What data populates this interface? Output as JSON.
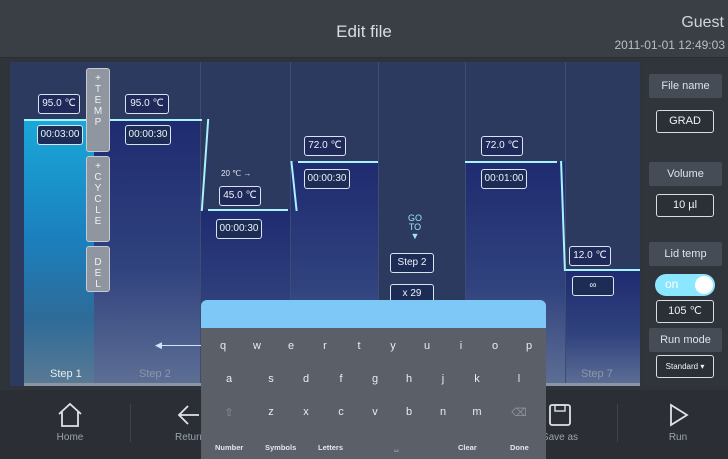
{
  "header": {
    "title": "Edit file",
    "user": "Guest",
    "datetime": "2011-01-01 12:49:03"
  },
  "side_buttons": {
    "temp": [
      "+",
      "T",
      "E",
      "M",
      "P"
    ],
    "cycle": [
      "+",
      "C",
      "Y",
      "C",
      "L",
      "E"
    ],
    "del": [
      "D",
      "E",
      "L"
    ]
  },
  "steps": [
    {
      "label": "Step 1",
      "temp": "95.0 ℃",
      "time": "00:03:00"
    },
    {
      "label": "Step 2",
      "temp": "95.0 ℃",
      "time": "00:00:30"
    },
    {
      "label": "",
      "temp": "45.0 ℃",
      "time": "00:00:30",
      "gradient": "20 ℃ →"
    },
    {
      "label": "",
      "temp": "72.0 ℃",
      "time": "00:00:30"
    },
    {
      "goto": "GO\nTO",
      "goto_step": "Step 2",
      "repeat": "x 29"
    },
    {
      "label": "",
      "temp": "72.0 ℃",
      "time": "00:01:00"
    },
    {
      "label": "Step 7",
      "temp": "12.0 ℃",
      "time": "∞"
    }
  ],
  "panel": {
    "file_name_label": "File name",
    "file_name": "GRAD",
    "volume_label": "Volume",
    "volume": "10 µl",
    "lid_label": "Lid temp",
    "lid_toggle": "on",
    "lid_value": "105 ℃",
    "run_mode_label": "Run mode",
    "run_mode": "Standard"
  },
  "bottom": {
    "home": "Home",
    "return": "Return",
    "save_as": "Save as",
    "run": "Run"
  },
  "keyboard": {
    "row1": [
      "q",
      "w",
      "e",
      "r",
      "t",
      "y",
      "u",
      "i",
      "o",
      "p"
    ],
    "row2": [
      "a",
      "s",
      "d",
      "f",
      "g",
      "h",
      "j",
      "k",
      "l"
    ],
    "row3": [
      "z",
      "x",
      "c",
      "v",
      "b",
      "n",
      "m"
    ],
    "functions": {
      "number": "Number",
      "symbols": "Symbols",
      "letters": "Letters",
      "clear": "Clear",
      "done": "Done"
    }
  }
}
